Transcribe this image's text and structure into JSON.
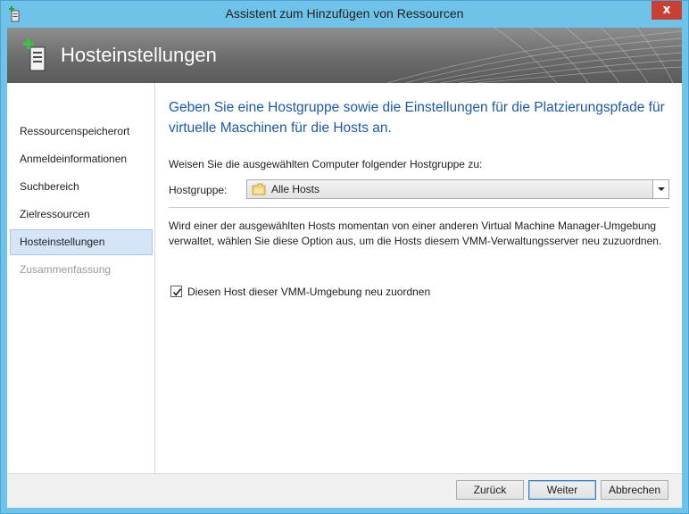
{
  "window": {
    "title": "Assistent zum Hinzufügen von Ressourcen",
    "close_glyph": "x",
    "icon": "add-host-wizard-icon",
    "frame_color": "#6fc3e9",
    "close_color": "#c74033"
  },
  "banner": {
    "title": "Hosteinstellungen",
    "icon": "add-host-icon"
  },
  "nav": {
    "items": [
      {
        "label": "Ressourcenspeicherort",
        "state": "normal"
      },
      {
        "label": "Anmeldeinformationen",
        "state": "normal"
      },
      {
        "label": "Suchbereich",
        "state": "normal"
      },
      {
        "label": "Zielressourcen",
        "state": "normal"
      },
      {
        "label": "Hosteinstellungen",
        "state": "active"
      },
      {
        "label": "Zusammenfassung",
        "state": "disabled"
      }
    ]
  },
  "main": {
    "heading": "Geben Sie eine Hostgruppe sowie die Einstellungen für die Platzierungspfade für virtuelle Maschinen für die Hosts an.",
    "instruction": "Weisen Sie die ausgewählten Computer folgender Hostgruppe zu:",
    "hostgroup_label": "Hostgruppe:",
    "hostgroup_value": "Alle Hosts",
    "hostgroup_icon": "host-group-folder-icon",
    "note": "Wird einer der ausgewählten Hosts momentan von einer anderen Virtual Machine Manager-Umgebung verwaltet, wählen Sie diese Option aus, um die Hosts diesem VMM-Verwaltungsserver neu zuzuordnen.",
    "checkbox_label": "Diesen Host dieser VMM-Umgebung neu zuordnen",
    "checkbox_checked": true,
    "heading_color": "#1c5aa8"
  },
  "footer": {
    "back_label": "Zurück",
    "next_label": "Weiter",
    "cancel_label": "Abbrechen"
  }
}
